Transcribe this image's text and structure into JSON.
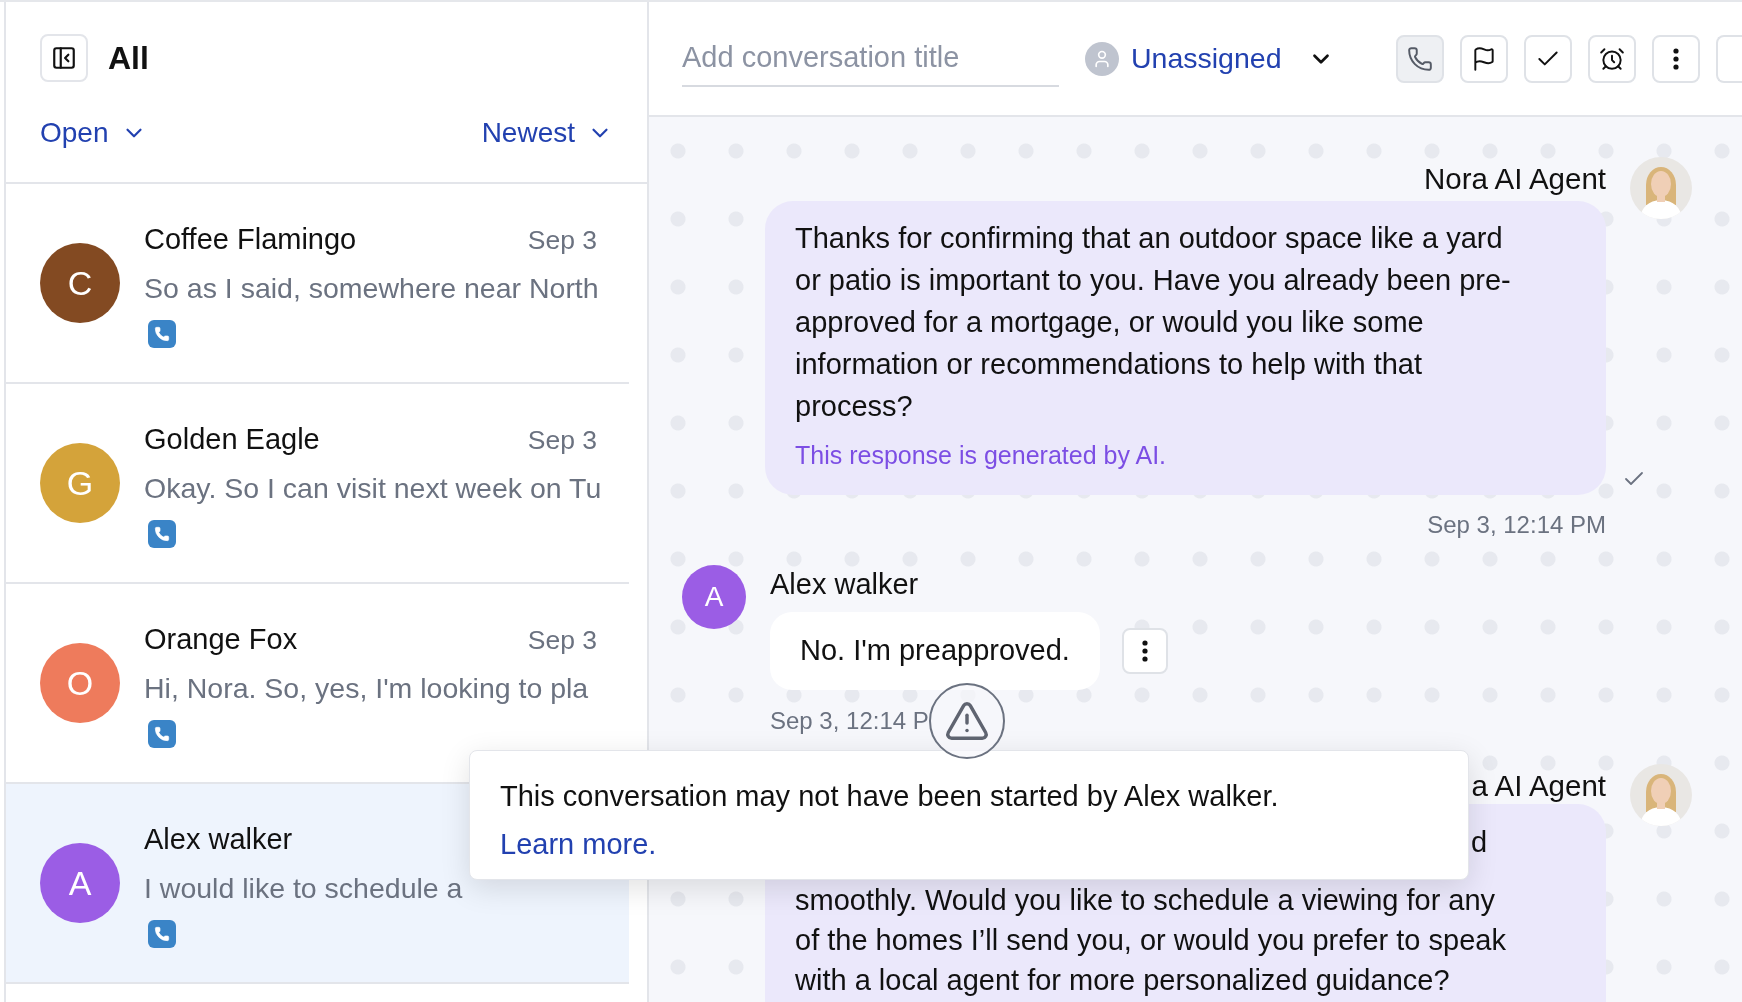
{
  "list_header": {
    "title": "All"
  },
  "filters": [
    {
      "label": "Open"
    },
    {
      "label": "Newest"
    }
  ],
  "conversations": [
    {
      "initial": "C",
      "color": "#834a22",
      "name": "Coffee Flamingo",
      "date": "Sep 3",
      "preview": "So as I said, somewhere near North",
      "phone": true,
      "selected": false
    },
    {
      "initial": "G",
      "color": "#d4a33a",
      "name": "Golden Eagle",
      "date": "Sep 3",
      "preview": "Okay. So I can visit next week on Tu",
      "phone": true,
      "selected": false
    },
    {
      "initial": "O",
      "color": "#ee7b5c",
      "name": "Orange Fox",
      "date": "Sep 3",
      "preview": "Hi, Nora. So, yes, I'm looking to pla",
      "phone": true,
      "selected": false
    },
    {
      "initial": "A",
      "color": "#9b5de5",
      "name": "Alex walker",
      "preview": "I would like to schedule a",
      "phone": true,
      "selected": true
    }
  ],
  "chat_header": {
    "title_placeholder": "Add conversation title",
    "assignee": "Unassigned",
    "toolbar": [
      {
        "kind": "phone",
        "selected": true
      },
      {
        "kind": "flag",
        "selected": false
      },
      {
        "kind": "check",
        "selected": false
      },
      {
        "kind": "alarm",
        "selected": false
      },
      {
        "kind": "more",
        "selected": false
      }
    ]
  },
  "messages": [
    {
      "kind": "agent",
      "sender": "Nora AI Agent",
      "text": "Thanks for confirming that an outdoor space like a yard or patio is important to you. Have you already been pre-approved for a mortgage, or would you like some information or recommendations to help with that process?",
      "note": "This response is generated by AI.",
      "time": "Sep 3, 12:14 PM",
      "delivered": true
    },
    {
      "kind": "customer",
      "sender": "Alex walker",
      "initial": "A",
      "color": "#9b5de5",
      "text": "No. I'm preapproved.",
      "time": "Sep 3, 12:14 P",
      "warning": true
    },
    {
      "kind": "agent_partial",
      "sender": "a AI Agent",
      "lines": [
        "d",
        "smoothly. Would you like to schedule a viewing for any",
        "of the homes I’ll send you, or would you prefer to speak",
        "with a local agent for more personalized guidance?"
      ]
    }
  ],
  "popover": {
    "text": "This conversation may not have been started by Alex walker.",
    "link": "Learn more."
  }
}
